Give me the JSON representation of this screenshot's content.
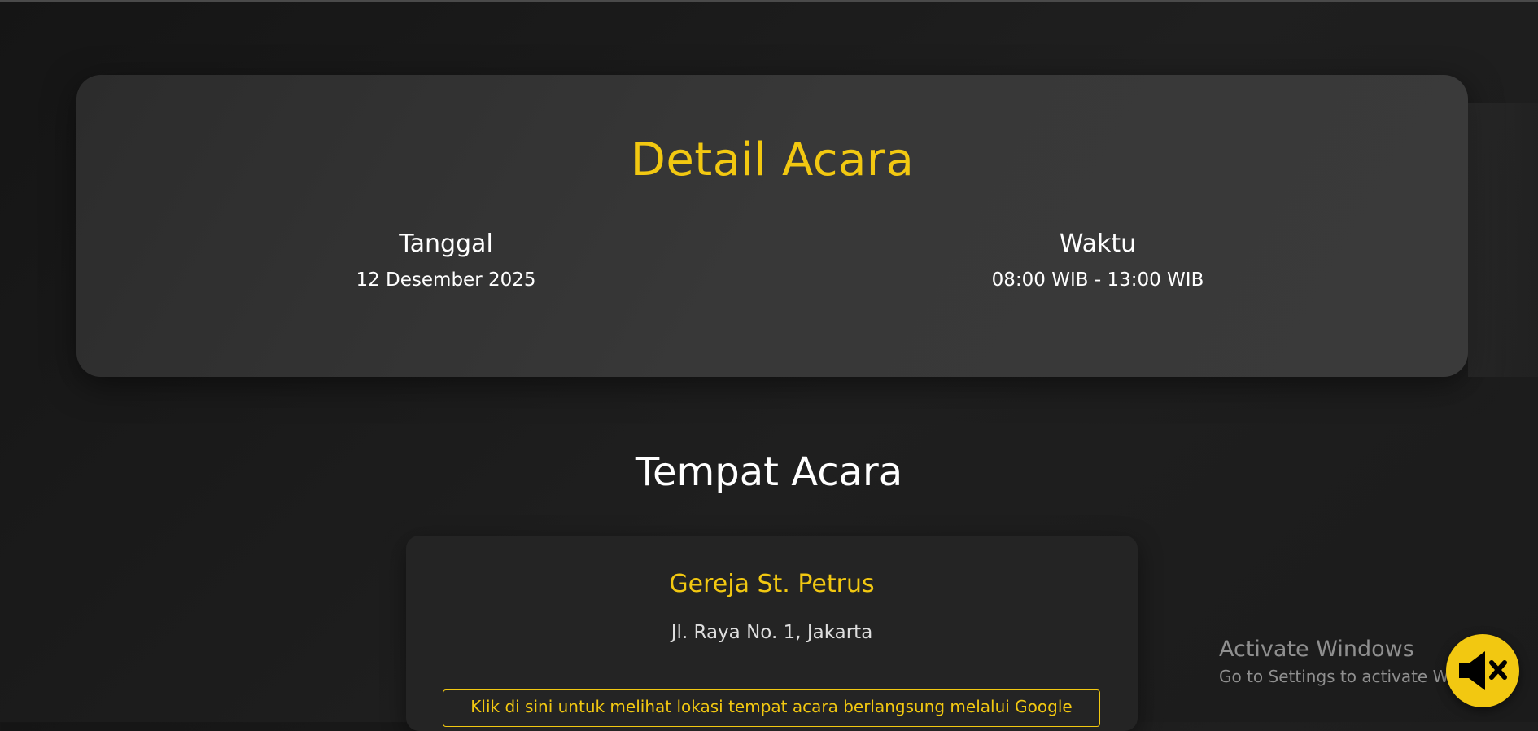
{
  "event": {
    "title": "Detail Acara",
    "date_label": "Tanggal",
    "date_value": "12 Desember 2025",
    "time_label": "Waktu",
    "time_value": "08:00 WIB - 13:00 WIB"
  },
  "venue": {
    "heading": "Tempat Acara",
    "name": "Gereja St. Petrus",
    "address": "Jl. Raya No. 1, Jakarta",
    "maps_link_label": "Klik di sini untuk melihat lokasi tempat acara berlangsung melalui Google"
  },
  "watermark": {
    "title": "Activate Windows",
    "subtitle": "Go to Settings to activate Windows."
  },
  "audio": {
    "icon": "speaker-muted-icon"
  },
  "colors": {
    "accent": "#f2c811",
    "background": "#1b1b1b",
    "card": "#383838",
    "venue_card": "#242424"
  }
}
